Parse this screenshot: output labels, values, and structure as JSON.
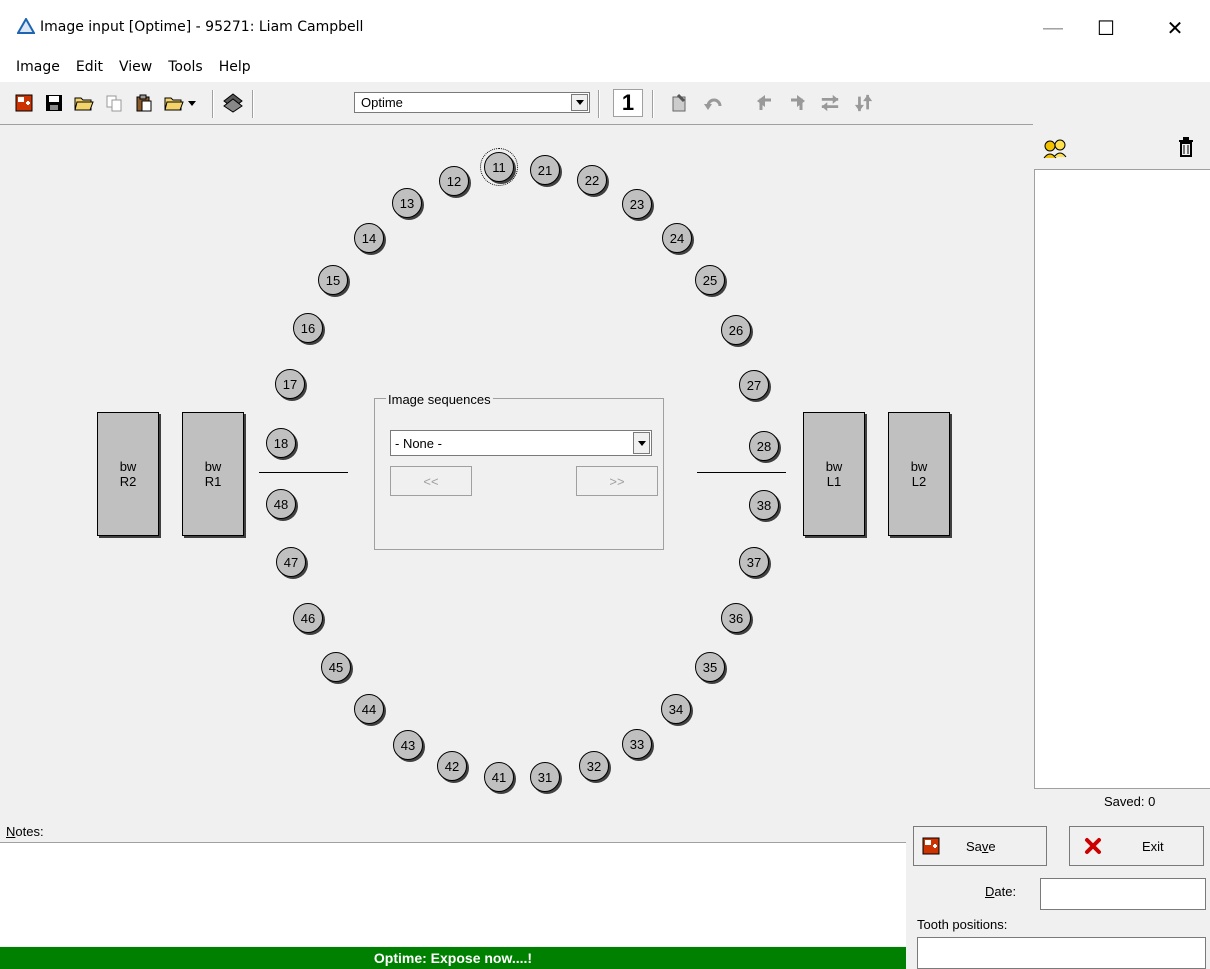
{
  "window": {
    "title": "Image input [Optime] - 95271: Liam Campbell",
    "minimize_glyph": "—",
    "maximize_glyph": "☐",
    "close_glyph": "✕"
  },
  "menu": [
    "Image",
    "Edit",
    "View",
    "Tools",
    "Help"
  ],
  "toolbar": {
    "device_select": "Optime",
    "counter": "1"
  },
  "teeth": [
    "11",
    "12",
    "13",
    "14",
    "15",
    "16",
    "17",
    "18",
    "21",
    "22",
    "23",
    "24",
    "25",
    "26",
    "27",
    "28",
    "31",
    "32",
    "33",
    "34",
    "35",
    "36",
    "37",
    "38",
    "41",
    "42",
    "43",
    "44",
    "45",
    "46",
    "47",
    "48"
  ],
  "bitewings": [
    {
      "line1": "bw",
      "line2": "R2"
    },
    {
      "line1": "bw",
      "line2": "R1"
    },
    {
      "line1": "bw",
      "line2": "L1"
    },
    {
      "line1": "bw",
      "line2": "L2"
    }
  ],
  "image_sequences": {
    "label": "Image sequences",
    "selected": "- None -",
    "prev_label": "<<",
    "next_label": ">>"
  },
  "right_panel": {
    "saved_label": "Saved: 0"
  },
  "notes": {
    "label_prefix": "N",
    "label_rest": "otes:"
  },
  "status": "Optime: Expose now....!",
  "actions": {
    "save_pre": "Sa",
    "save_u": "v",
    "save_post": "e",
    "exit_label": "Exit",
    "date_u": "D",
    "date_rest": "ate:",
    "tooth_positions_label": "Tooth positions:"
  },
  "colors": {
    "status_bg": "#008000",
    "tooth_fill": "#c0c0c0",
    "accent_blue": "#1e64b4",
    "exit_red": "#cc0000"
  }
}
